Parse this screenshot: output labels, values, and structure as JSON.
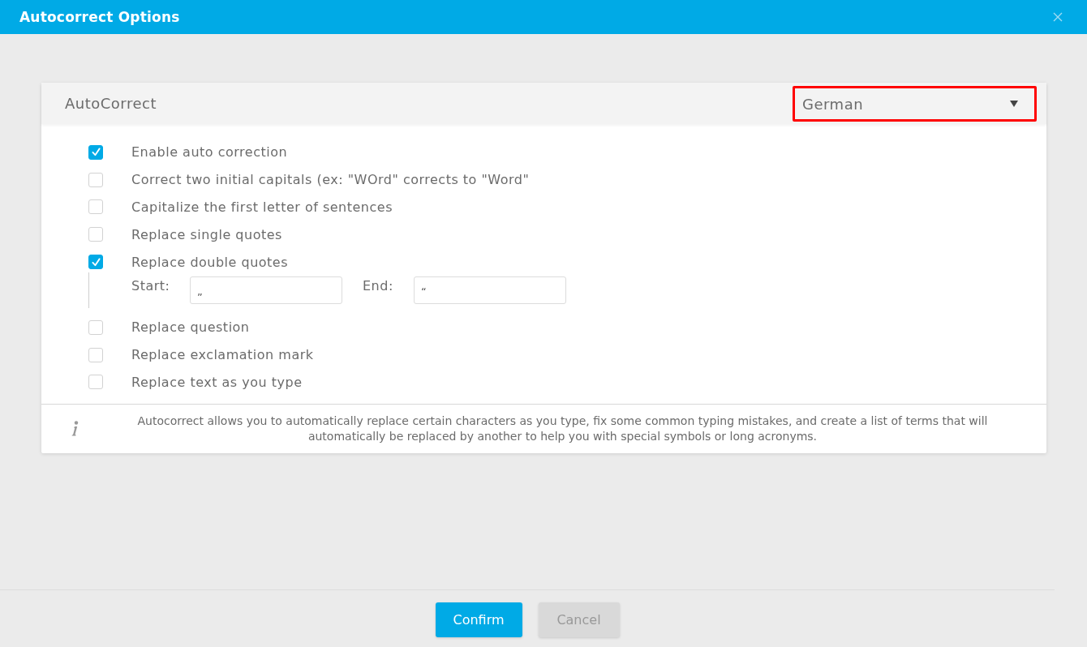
{
  "window": {
    "title": "Autocorrect Options"
  },
  "panel": {
    "title": "AutoCorrect",
    "language_select": {
      "value": "German",
      "highlighted": true
    }
  },
  "options": [
    {
      "label": "Enable auto correction",
      "checked": true
    },
    {
      "label": "Correct two initial capitals (ex: \"WOrd\" corrects to \"Word\"",
      "checked": false
    },
    {
      "label": "Capitalize the first letter of sentences",
      "checked": false
    },
    {
      "label": "Replace single quotes",
      "checked": false
    },
    {
      "label": "Replace double quotes",
      "checked": true,
      "fields": [
        {
          "label": "Start:",
          "value": "„"
        },
        {
          "label": "End:",
          "value": "“"
        }
      ]
    },
    {
      "label": "Replace question",
      "checked": false
    },
    {
      "label": "Replace exclamation mark",
      "checked": false
    },
    {
      "label": "Replace text as you type",
      "checked": false
    }
  ],
  "info": {
    "text": "Autocorrect allows you to automatically replace certain characters as you type, fix some common typing mistakes, and create a list of terms that will automatically be replaced by another to help you with special symbols or long acronyms."
  },
  "buttons": [
    {
      "label": "Confirm",
      "kind": "primary"
    },
    {
      "label": "Cancel",
      "kind": "secondary"
    }
  ]
}
